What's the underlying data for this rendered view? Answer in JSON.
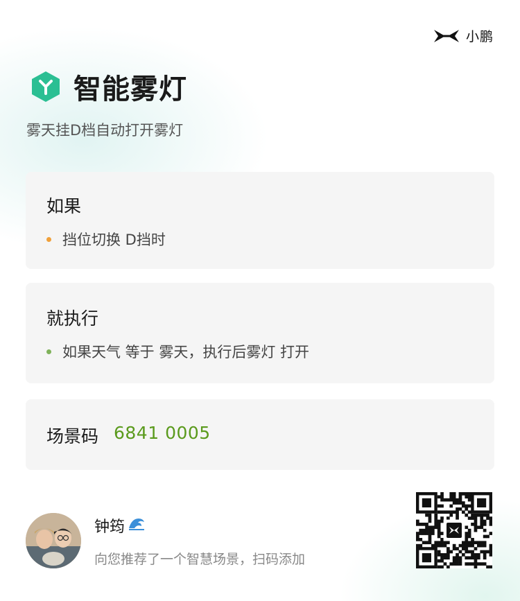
{
  "brand": {
    "name": "小鹏",
    "icon": "xpeng-logo-icon"
  },
  "header": {
    "title": "智能雾灯",
    "subtitle": "雾天挂D档自动打开雾灯",
    "icon": "y-hexagon-icon",
    "accent": "#2bbf93"
  },
  "if_card": {
    "title": "如果",
    "condition": "挡位切换 D挡时",
    "bullet_color": "#f0a03a"
  },
  "then_card": {
    "title": "就执行",
    "action": "如果天气 等于 雾天，执行后雾灯 打开",
    "bullet_color": "#7fb25a"
  },
  "scene_code": {
    "label": "场景码",
    "value": "6841 0005",
    "color": "#5a9a1c"
  },
  "footer": {
    "user_name": "钟筠",
    "name_emoji": "🌊",
    "message": "向您推荐了一个智慧场景，扫码添加",
    "avatar": "avatar-photo",
    "qr": "qr-code-icon"
  }
}
